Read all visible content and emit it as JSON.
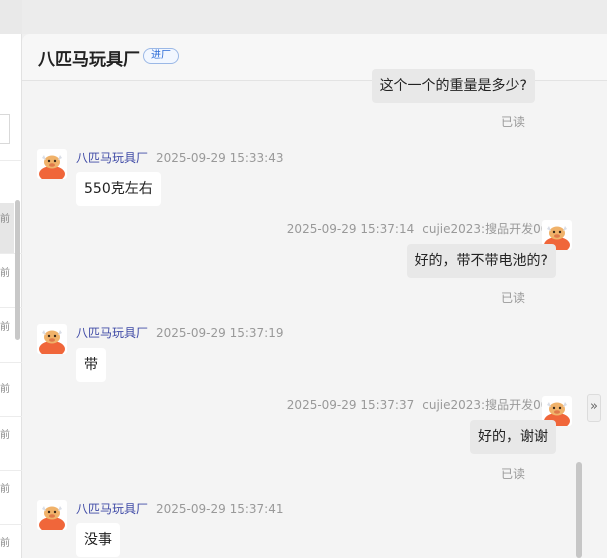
{
  "left_list": {
    "time_suffix": "前"
  },
  "chat": {
    "title": "八匹马玩具厂",
    "badge": "进厂",
    "messages": [
      {
        "kind": "out",
        "text": "这个一个的重量是多少?",
        "read": "已读"
      },
      {
        "kind": "in",
        "sender": "八匹马玩具厂",
        "time": "2025-09-29 15:33:43",
        "text": "550克左右"
      },
      {
        "kind": "out",
        "time": "2025-09-29 15:37:14",
        "sender": "cujie2023:搜品开发007",
        "text": "好的，带不带电池的?",
        "read": "已读"
      },
      {
        "kind": "in",
        "sender": "八匹马玩具厂",
        "time": "2025-09-29 15:37:19",
        "text": "带"
      },
      {
        "kind": "out",
        "time": "2025-09-29 15:37:37",
        "sender": "cujie2023:搜品开发007",
        "text": "好的，谢谢",
        "read": "已读"
      },
      {
        "kind": "in",
        "sender": "八匹马玩具厂",
        "time": "2025-09-29 15:37:41",
        "text": "没事"
      }
    ]
  },
  "icons": {
    "expand": "double-chevron-right-icon",
    "avatar": "cartoon-cow-avatar-icon"
  },
  "colors": {
    "sender_name": "#3f4aa6",
    "badge": "#2b6bd6",
    "avatar_orange": "#f0663a"
  }
}
